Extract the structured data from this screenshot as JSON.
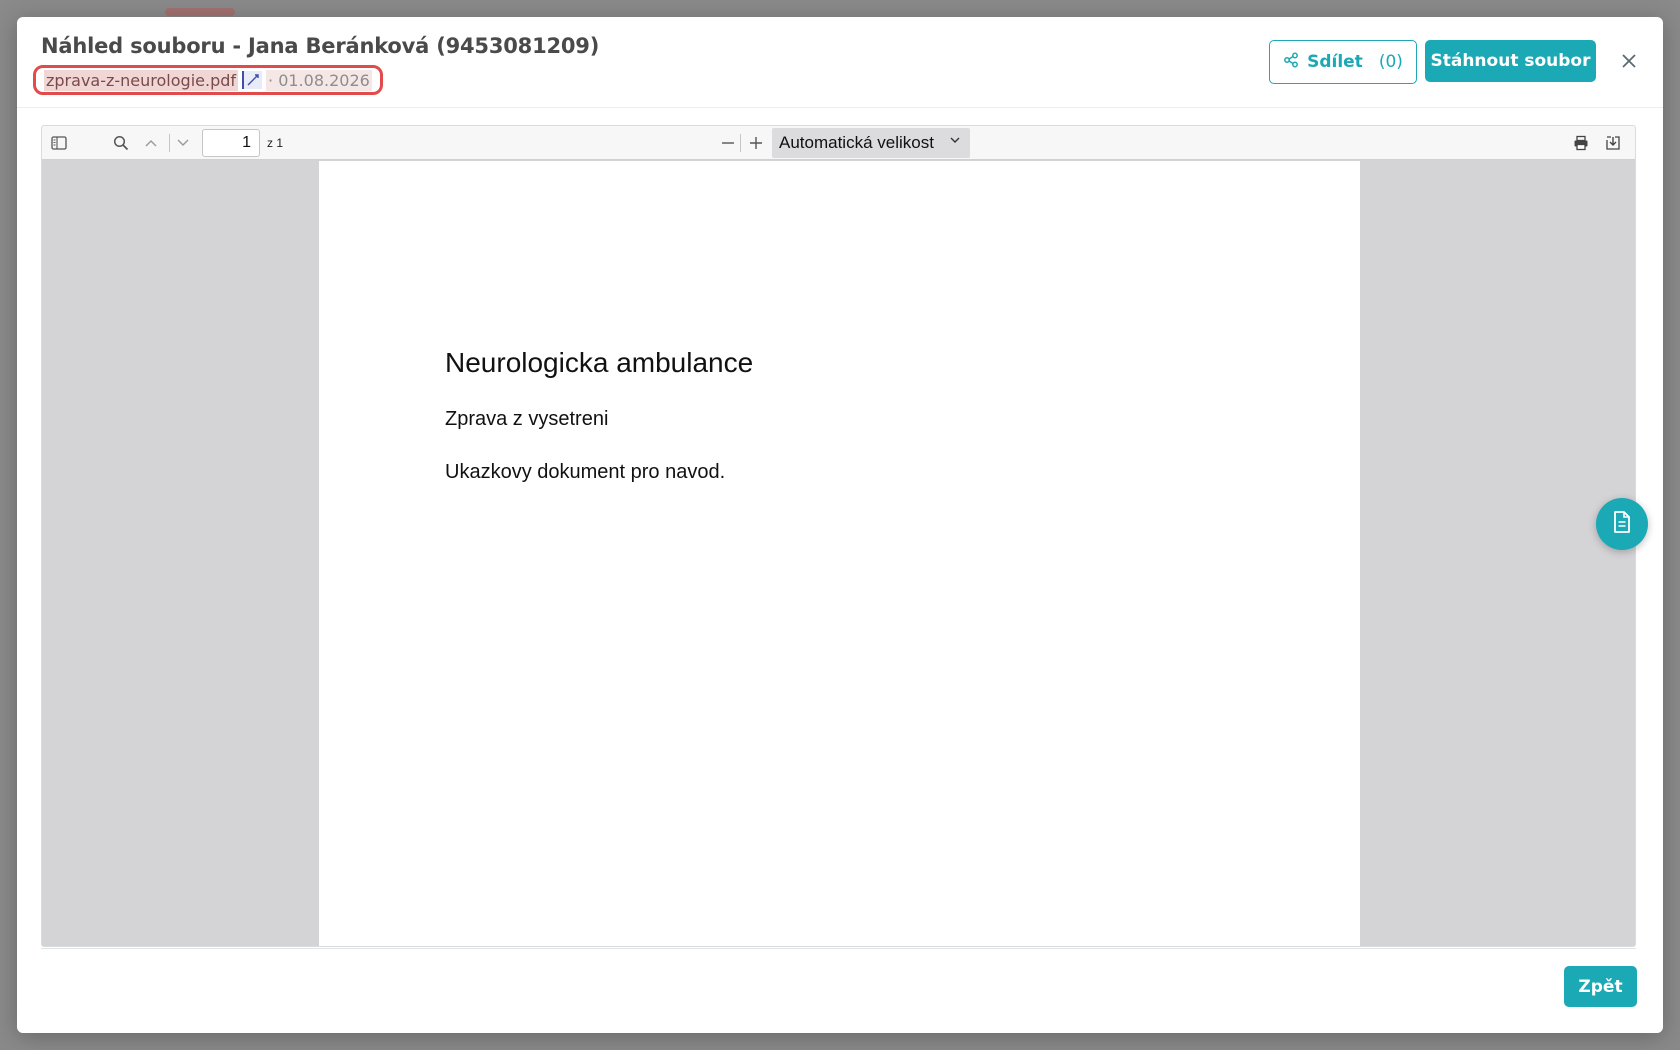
{
  "modal": {
    "title": "Náhled souboru - Jana Beránková (9453081209)",
    "file_name": "zprava-z-neurologie.pdf",
    "file_date": "· 01.08.2026",
    "share_label": "Sdílet",
    "share_count": "(0)",
    "download_label": "Stáhnout soubor",
    "close_icon": "close-icon",
    "back_label": "Zpět"
  },
  "viewer": {
    "page_number": "1",
    "page_of": "z 1",
    "zoom_label": "Automatická velikost",
    "zoom_out_icon": "minus-icon",
    "zoom_in_icon": "plus-icon"
  },
  "document": {
    "heading": "Neurologicka ambulance",
    "line1": "Zprava z vysetreni",
    "line2": "Ukazkovy dokument pro navod."
  },
  "colors": {
    "accent": "#1aa9b5",
    "highlight_border": "#e24b4b"
  }
}
